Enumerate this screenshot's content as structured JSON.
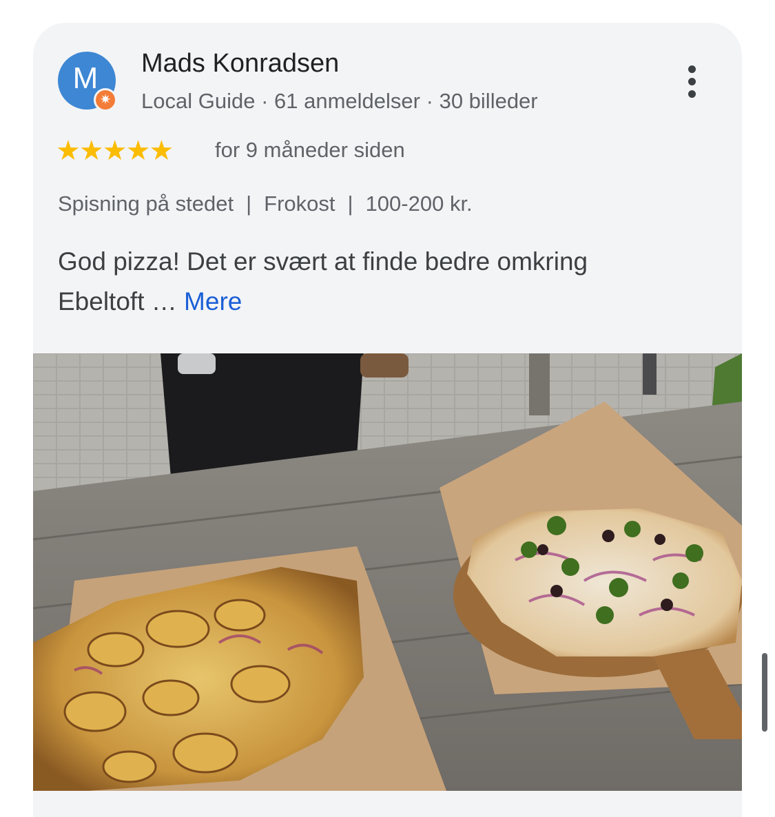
{
  "review": {
    "author": {
      "initial": "M",
      "name": "Mads Konradsen",
      "level": "Local Guide",
      "reviews_count": "61 anmeldelser",
      "photos_count": "30 billeder",
      "meta_separator": "·",
      "badge_icon": "star-badge-icon",
      "avatar_color": "#3d87d4",
      "badge_color": "#f37c36"
    },
    "rating": {
      "stars": 5,
      "max": 5,
      "stars_display": "★★★★★",
      "star_color": "#fbbc04"
    },
    "time_ago": "for 9 måneder siden",
    "tags": [
      "Spisning på stedet",
      "Frokost",
      "100-200 kr."
    ],
    "tag_separator": "|",
    "text_line1": "God pizza! Det er svært at finde bedre omkring",
    "text_line2": "Ebeltoft …",
    "more_label": "Mere",
    "link_color": "#1a5fd6",
    "photo": {
      "icon": "pizza-photo"
    }
  },
  "menu_icon": "more-vert-icon"
}
